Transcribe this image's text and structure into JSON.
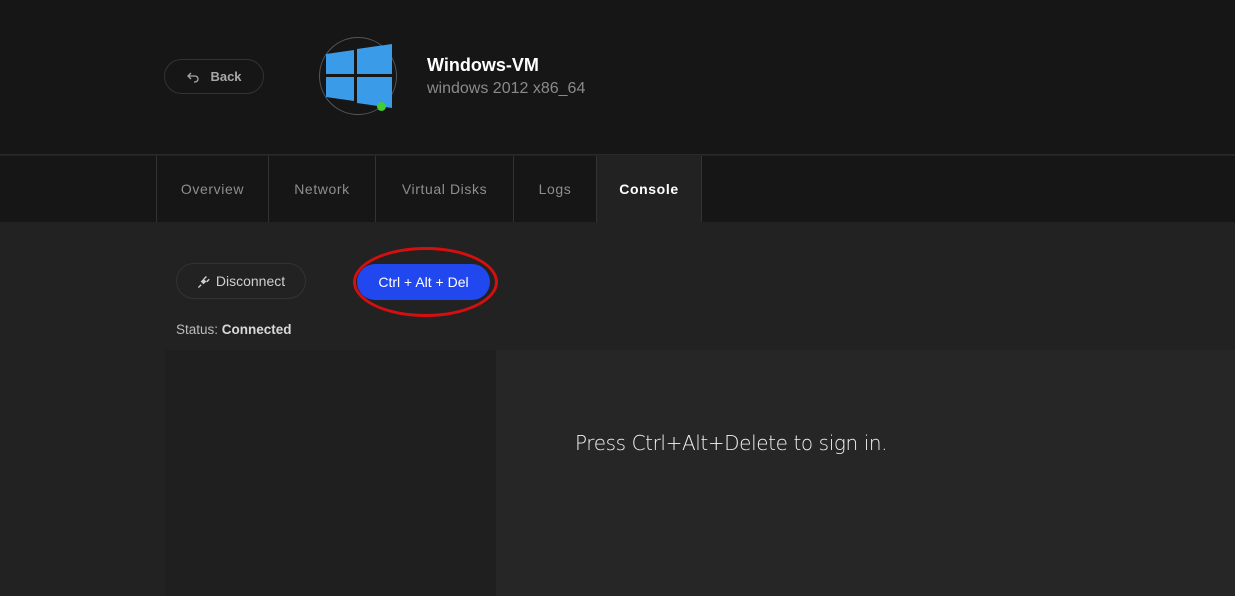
{
  "header": {
    "back_label": "Back",
    "vm_name": "Windows-VM",
    "vm_os": "windows 2012 x86_64",
    "logo_icon": "windows-logo-icon",
    "status_dot_color": "#44cc33"
  },
  "tabs": [
    {
      "label": "Overview",
      "active": false
    },
    {
      "label": "Network",
      "active": false
    },
    {
      "label": "Virtual Disks",
      "active": false
    },
    {
      "label": "Logs",
      "active": false
    },
    {
      "label": "Console",
      "active": true
    }
  ],
  "console": {
    "disconnect_label": "Disconnect",
    "cad_label": "Ctrl + Alt + Del",
    "status_label": "Status:",
    "status_value": "Connected",
    "screen_message": "Press Ctrl+Alt+Delete to sign in."
  },
  "colors": {
    "accent": "#2147ee",
    "highlight": "#d40f0f",
    "windows_blue": "#3a9be8"
  }
}
